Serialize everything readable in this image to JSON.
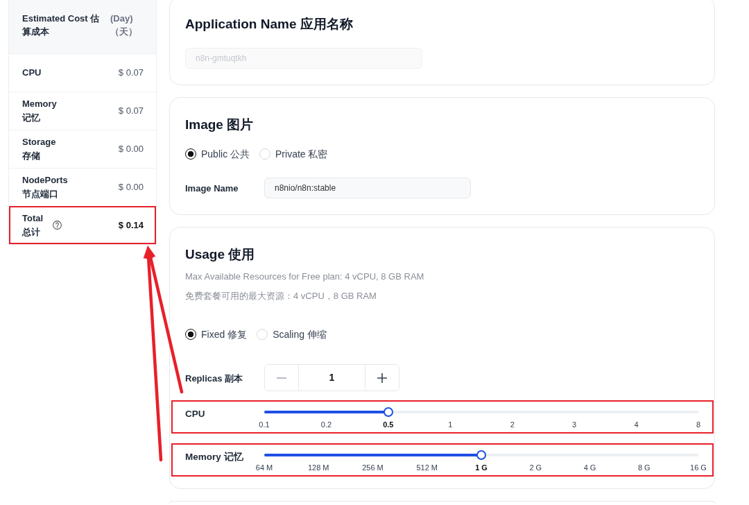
{
  "cost_panel": {
    "header": {
      "title": "Estimated Cost 估算成本",
      "unit": "(Day)（天）"
    },
    "rows": [
      {
        "kind": "item",
        "label": "CPU",
        "value": "$ 0.07",
        "highlighted": false
      },
      {
        "kind": "item",
        "label": "Memory 记忆",
        "value": "$ 0.07",
        "highlighted": false
      },
      {
        "kind": "item",
        "label": "Storage 存储",
        "value": "$ 0.00",
        "highlighted": false
      },
      {
        "kind": "item",
        "label": "NodePorts 节点端口",
        "value": "$ 0.00",
        "highlighted": false
      },
      {
        "kind": "total",
        "label": "Total 总计",
        "value": "$ 0.14",
        "highlighted": true
      }
    ]
  },
  "application_name": {
    "title": "Application Name 应用名称",
    "field": {
      "value": "n8n-gmtuqtkh",
      "disabled": true
    }
  },
  "image": {
    "title": "Image 图片",
    "options": [
      {
        "label": "Public 公共",
        "selected": true
      },
      {
        "label": "Private 私密",
        "selected": false
      }
    ],
    "name_field": {
      "label": "Image Name",
      "value": "n8nio/n8n:stable"
    }
  },
  "usage": {
    "title": "Usage 使用",
    "notes": [
      "Max Available Resources for Free plan: 4 vCPU, 8 GB RAM",
      "免费套餐可用的最大资源：4 vCPU，8 GB RAM"
    ],
    "modes": [
      {
        "label": "Fixed 修复",
        "selected": true
      },
      {
        "label": "Scaling 伸缩",
        "selected": false
      }
    ],
    "replicas": {
      "label": "Replicas 副本",
      "value": "1"
    },
    "sliders": [
      {
        "label": "CPU",
        "ticks": [
          "0.1",
          "0.2",
          "0.5",
          "1",
          "2",
          "3",
          "4",
          "8"
        ],
        "level": 0.2857,
        "highlighted": true
      },
      {
        "label": "Memory 记忆",
        "ticks": [
          "64 M",
          "128 M",
          "256 M",
          "512 M",
          "1 G",
          "2 G",
          "4 G",
          "8 G",
          "16 G"
        ],
        "level": 0.5,
        "highlighted": true
      }
    ]
  }
}
